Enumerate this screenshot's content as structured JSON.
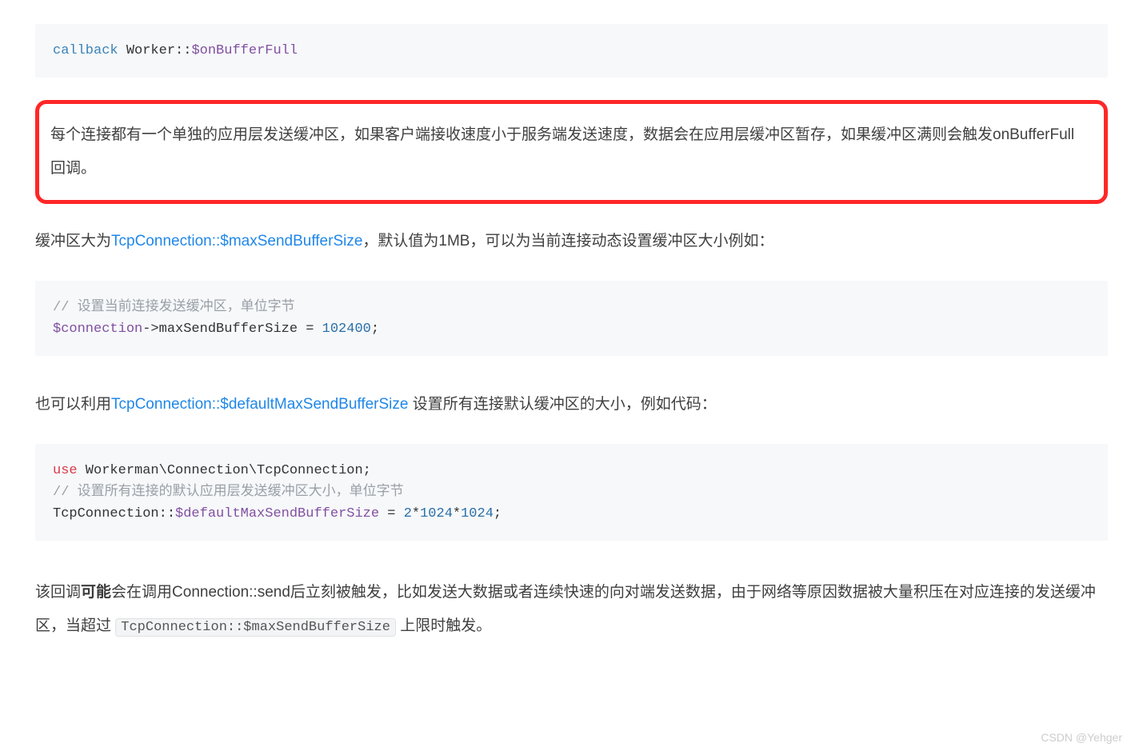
{
  "code1": {
    "t_callback": "callback ",
    "t_worker": "Worker",
    "t_colons": "::",
    "t_var": "$onBufferFull"
  },
  "highlighted": "每个连接都有一个单独的应用层发送缓冲区，如果客户端接收速度小于服务端发送速度，数据会在应用层缓冲区暂存，如果缓冲区满则会触发onBufferFull回调。",
  "para2_pre": "缓冲区大为",
  "para2_link": "TcpConnection::$maxSendBufferSize",
  "para2_post": "，默认值为1MB，可以为当前连接动态设置缓冲区大小例如：",
  "code2": {
    "comment": "// 设置当前连接发送缓冲区，单位字节",
    "var": "$connection",
    "arrow": "->maxSendBufferSize = ",
    "num": "102400",
    "semi": ";"
  },
  "para3_pre": "也可以利用",
  "para3_link": "TcpConnection::$defaultMaxSendBufferSize",
  "para3_post": " 设置所有连接默认缓冲区的大小，例如代码：",
  "code3": {
    "use": "use",
    "ns": " Workerman\\Connection\\TcpConnection;",
    "comment": "// 设置所有连接的默认应用层发送缓冲区大小，单位字节",
    "class": "TcpConnection",
    "cc": "::",
    "var": "$defaultMaxSendBufferSize",
    "eq": " = ",
    "num1": "2",
    "star1": "*",
    "num2": "1024",
    "star2": "*",
    "num3": "1024",
    "semi": ";"
  },
  "para4_pre": "该回调",
  "para4_bold": "可能",
  "para4_mid": "会在调用Connection::send后立刻被触发，比如发送大数据或者连续快速的向对端发送数据，由于网络等原因数据被大量积压在对应连接的发送缓冲区，当超过 ",
  "para4_code": "TcpConnection::$maxSendBufferSize",
  "para4_post": " 上限时触发。",
  "watermark": "CSDN @Yehger"
}
